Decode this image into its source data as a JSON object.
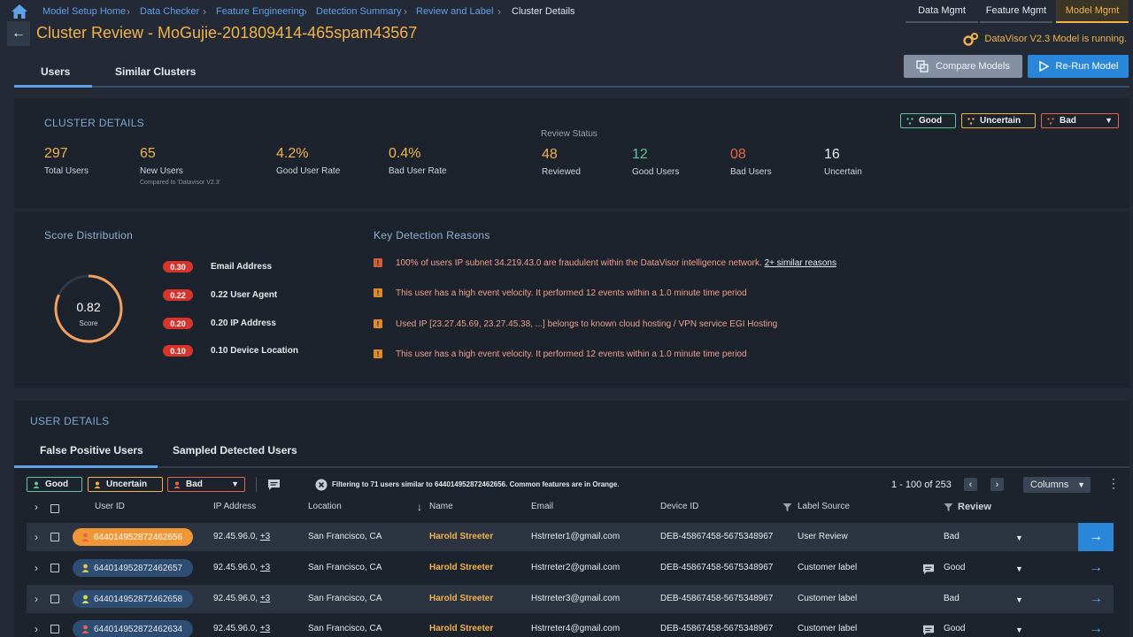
{
  "breadcrumb": [
    "Model Setup Home",
    "Data Checker",
    "Feature Engineering",
    "Detection Summary",
    "Review and Label",
    "Cluster Details"
  ],
  "top_nav": [
    "Data Mgmt",
    "Feature Mgmt",
    "Model Mgmt"
  ],
  "page_title": "Cluster Review - MoGujie-201809414-465spam43567",
  "model_status": "DataVisor V2.3 Model is running.",
  "tabs": [
    "Users",
    "Similar Clusters"
  ],
  "buttons": {
    "compare": "Compare Models",
    "rerun": "Re-Run Model"
  },
  "cluster": {
    "title": "CLUSTER DETAILS",
    "review_status_label": "Review Status",
    "stats": [
      {
        "value": "297",
        "label": "Total Users"
      },
      {
        "value": "65",
        "label": "New Users",
        "sub": "Compared to 'Datavisor V2.3'"
      },
      {
        "value": "4.2%",
        "label": "Good User Rate"
      },
      {
        "value": "0.4%",
        "label": "Bad User Rate"
      },
      {
        "value": "48",
        "label": "Reviewed"
      },
      {
        "value": "12",
        "label": "Good Users"
      },
      {
        "value": "08",
        "label": "Bad Users"
      },
      {
        "value": "16",
        "label": "Uncertain"
      }
    ],
    "chips": [
      "Good",
      "Uncertain",
      "Bad"
    ]
  },
  "score": {
    "title": "Score Distribution",
    "value": "0.82",
    "value_num": 0.82,
    "label": "Score",
    "factors": [
      {
        "score": "0.30",
        "label": "Email Address"
      },
      {
        "score": "0.22",
        "label": "0.22 User Agent"
      },
      {
        "score": "0.20",
        "label": "0.20 IP Address"
      },
      {
        "score": "0.10",
        "label": "0.10 Device Location"
      }
    ]
  },
  "reasons": {
    "title": "Key Detection Reasons",
    "items": [
      "100% of users IP subnet 34.219.43.0 are fraudulent within the DataVisor intelligence network.",
      "This user has a high event velocity. It performed 12 events within a 1.0 minute time period",
      "Used IP [23.27.45.69, 23.27.45.38, ...] belongs to known cloud hosting / VPN service EGI Hosting",
      "This user has a high event velocity. It performed 12 events within a 1.0 minute time period"
    ],
    "more_link": "2+ similar reasons"
  },
  "user_details": {
    "title": "USER DETAILS",
    "tabs": [
      "False Positive Users",
      "Sampled Detected Users"
    ],
    "chips": [
      "Good",
      "Uncertain",
      "Bad"
    ],
    "filter_text": "Filtering to 71 users similar to 644014952872462656. Common features are in Orange.",
    "pagination": "1 - 100 of 253",
    "columns_label": "Columns",
    "headers": [
      "User ID",
      "IP Address",
      "Location",
      "Name",
      "Email",
      "Device ID",
      "Label Source",
      "Review"
    ],
    "rows": [
      {
        "uid": "644014952872462656",
        "ip": "92.45.96.0,",
        "ip_more": "+3",
        "location": "San Francisco, CA",
        "name": "Harold Streeter",
        "email": "Hstrreter1@gmail.com",
        "device": "DEB-45867458-5675348967",
        "source": "User Review",
        "review": "Bad"
      },
      {
        "uid": "644014952872462657",
        "ip": "92.45.96.0,",
        "ip_more": "+3",
        "location": "San Francisco, CA",
        "name": "Harold Streeter",
        "email": "Hstrreter2@gmail.com",
        "device": "DEB-45867458-5675348967",
        "source": "Customer label",
        "review": "Good"
      },
      {
        "uid": "644014952872462658",
        "ip": "92.45.96.0,",
        "ip_more": "+3",
        "location": "San Francisco, CA",
        "name": "Harold Streeter",
        "email": "Hstrreter3@gmail.com",
        "device": "DEB-45867458-5675348967",
        "source": "Customer label",
        "review": "Bad"
      },
      {
        "uid": "644014952872462634",
        "ip": "92.45.96.0,",
        "ip_more": "+3",
        "location": "San Francisco, CA",
        "name": "Harold Streeter",
        "email": "Hstrreter4@gmail.com",
        "device": "DEB-45867458-5675348967",
        "source": "Customer label",
        "review": "Good"
      }
    ]
  },
  "colors": {
    "accent": "#f1b24a",
    "primary": "#2a86d8",
    "good": "#5ec49a",
    "bad": "#e8654a"
  }
}
